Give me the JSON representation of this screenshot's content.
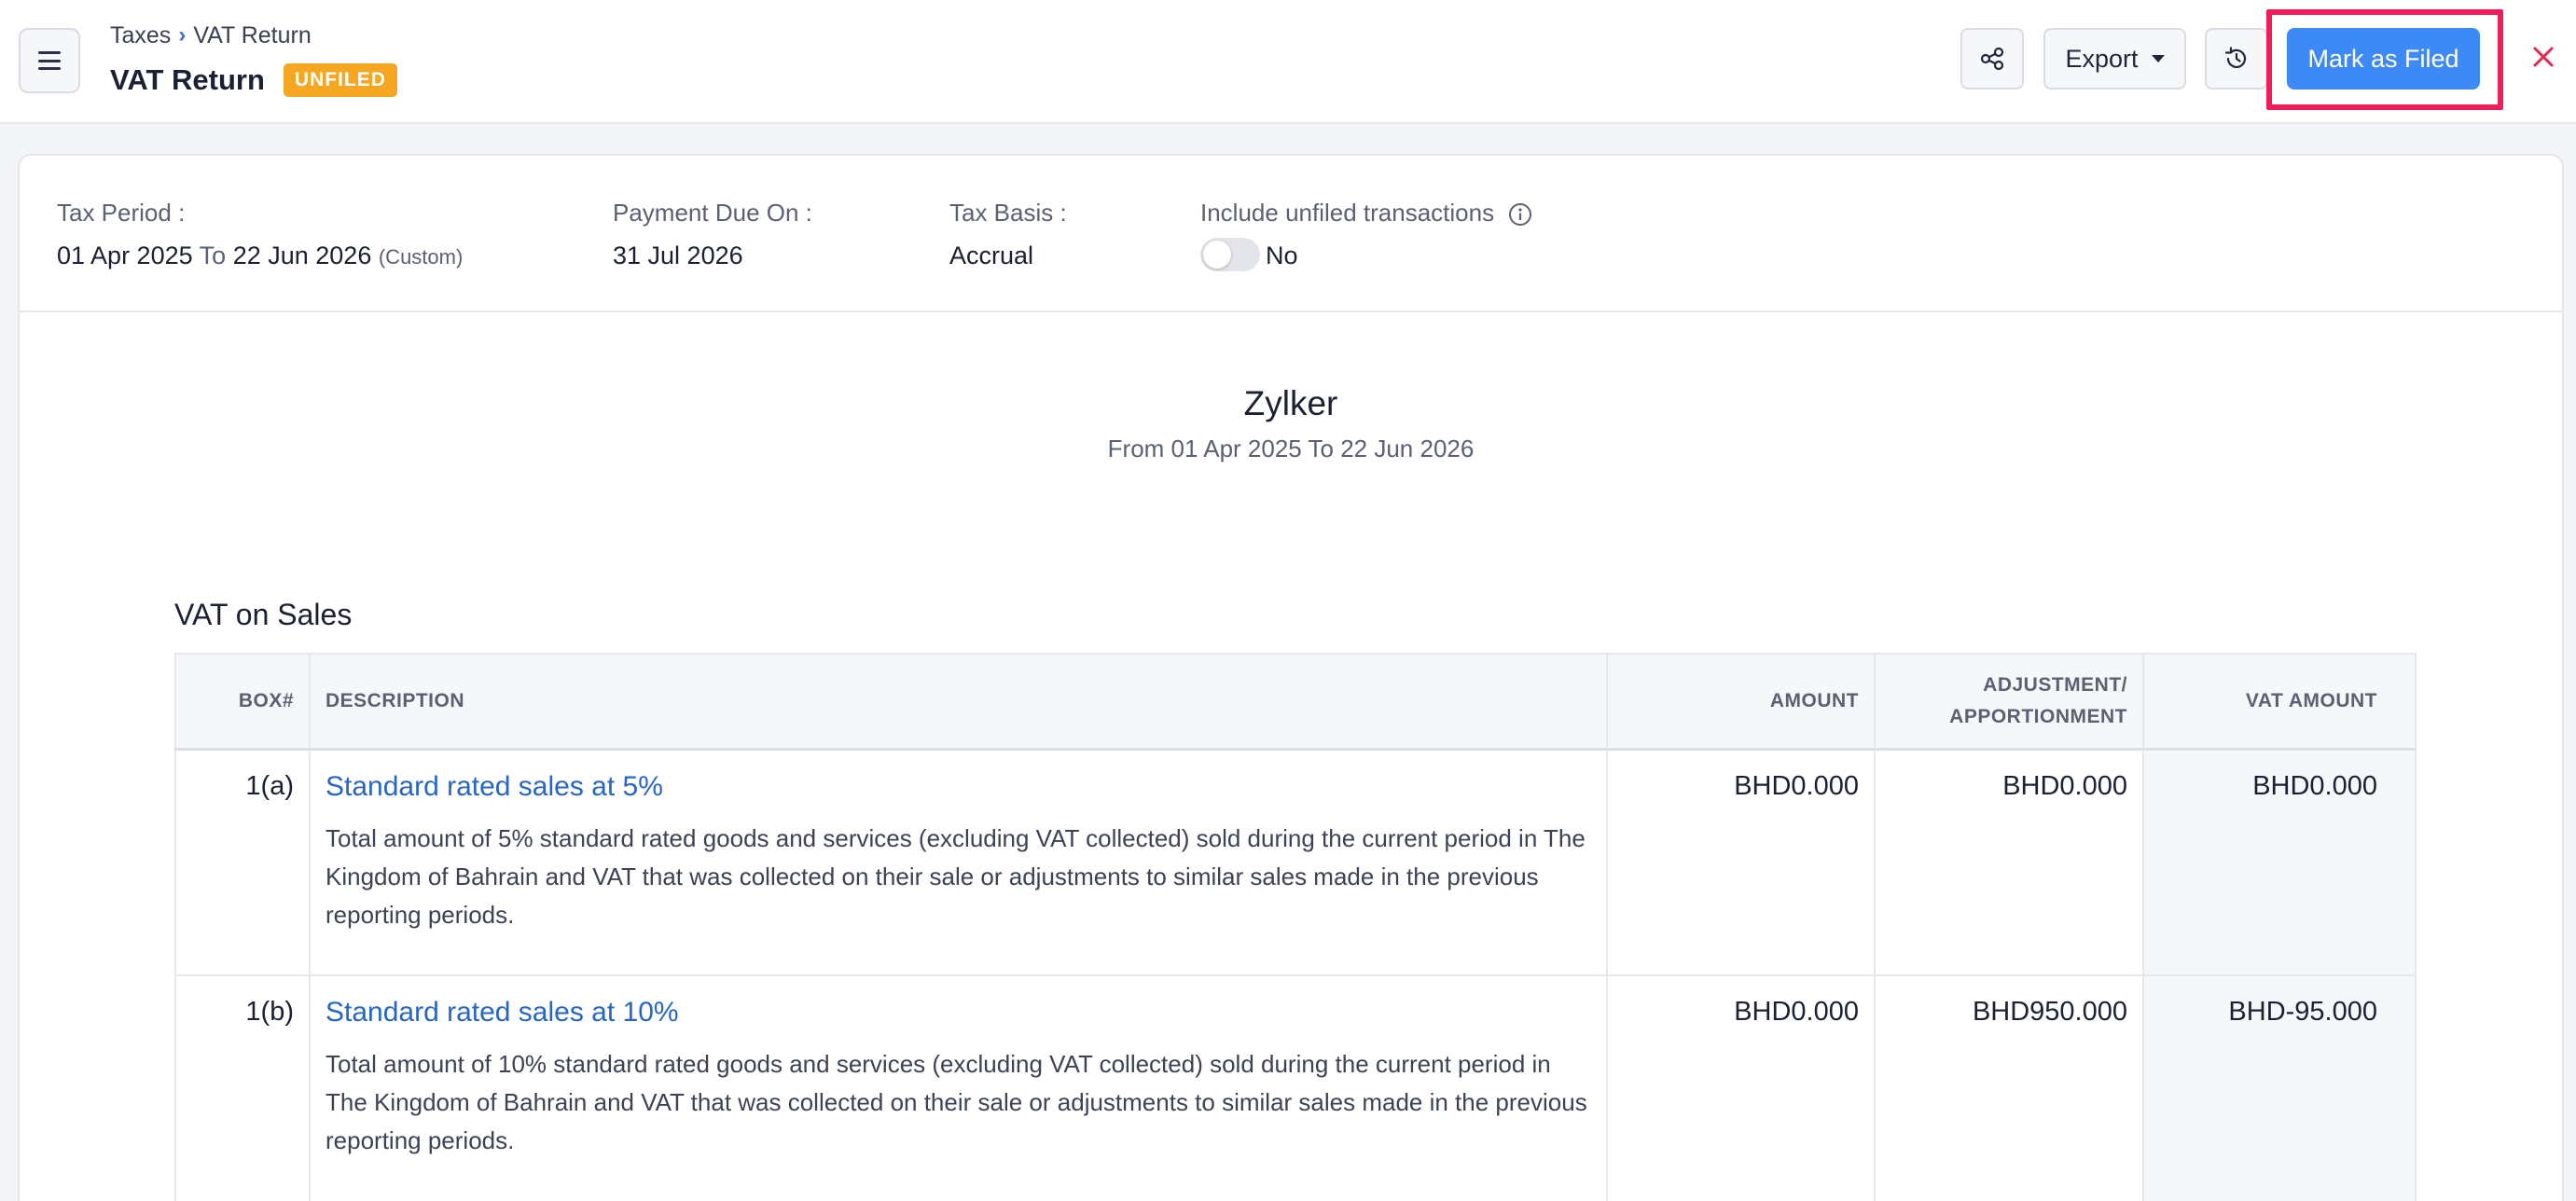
{
  "header": {
    "breadcrumb": {
      "parent": "Taxes",
      "current": "VAT Return"
    },
    "title": "VAT Return",
    "status": "UNFILED",
    "export_label": "Export",
    "mark_filed_label": "Mark as Filed",
    "colors": {
      "primary": "#3d8af7",
      "badge": "#f5a623",
      "highlight": "#ec1f5b",
      "close": "#e5274d"
    }
  },
  "filters": {
    "tax_period": {
      "label": "Tax Period :",
      "from": "01 Apr 2025",
      "to_word": "To",
      "to": "22 Jun 2026",
      "note": "(Custom)"
    },
    "payment_due": {
      "label": "Payment Due On :",
      "value": "31 Jul 2026"
    },
    "tax_basis": {
      "label": "Tax Basis :",
      "value": "Accrual"
    },
    "include_unfiled": {
      "label": "Include unfiled transactions",
      "value": "No",
      "enabled": false
    }
  },
  "report": {
    "org_name": "Zylker",
    "range": "From 01 Apr 2025  To 22 Jun 2026",
    "section_title": "VAT on Sales",
    "columns": {
      "box": "BOX#",
      "description": "DESCRIPTION",
      "amount": "AMOUNT",
      "adjustment_line1": "ADJUSTMENT/",
      "adjustment_line2": "APPORTIONMENT",
      "vat_amount": "VAT AMOUNT"
    },
    "rows": [
      {
        "box": "1(a)",
        "title": "Standard rated sales at 5%",
        "description": "Total amount of 5% standard rated goods and services (excluding VAT collected) sold during the current period in The Kingdom of Bahrain and VAT that was collected on their sale or adjustments to similar sales made in the previous reporting periods.",
        "amount": "BHD0.000",
        "adjustment": "BHD0.000",
        "vat_amount": "BHD0.000"
      },
      {
        "box": "1(b)",
        "title": "Standard rated sales at 10%",
        "description": "Total amount of 10% standard rated goods and services (excluding VAT collected) sold during the current period in The Kingdom of Bahrain and VAT that was collected on their sale or adjustments to similar sales made in the previous reporting periods.",
        "amount": "BHD0.000",
        "adjustment": "BHD950.000",
        "vat_amount": "BHD-95.000"
      }
    ]
  }
}
